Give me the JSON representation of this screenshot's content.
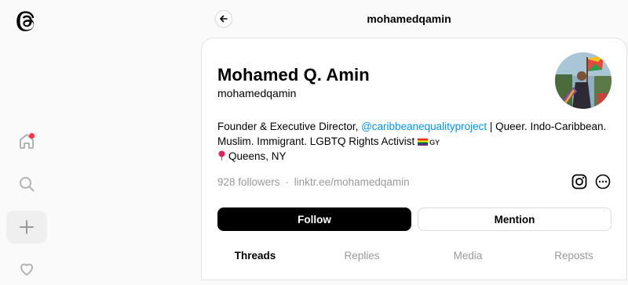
{
  "nav": {
    "items": [
      "home",
      "search",
      "create",
      "activity"
    ]
  },
  "header": {
    "title": "mohamedqamin"
  },
  "profile": {
    "name": "Mohamed Q. Amin",
    "handle": "mohamedqamin",
    "bio_line1_prefix": "Founder & Executive Director, ",
    "bio_mention": "@caribbeanequalityproject",
    "bio_line1_suffix": " | Queer. Indo-Caribbean.",
    "bio_line2": "Muslim. Immigrant. LGBTQ Rights Activist ",
    "bio_flag_code": "GY",
    "bio_location": "Queens, NY",
    "followers": "928 followers",
    "separator": "·",
    "link": "linktr.ee/mohamedqamin"
  },
  "actions": {
    "follow": "Follow",
    "mention": "Mention"
  },
  "tabs": [
    {
      "label": "Threads",
      "active": true
    },
    {
      "label": "Replies",
      "active": false
    },
    {
      "label": "Media",
      "active": false
    },
    {
      "label": "Reposts",
      "active": false
    }
  ],
  "colors": {
    "accent_link": "#0095f6",
    "notification": "#ff3040",
    "primary_button": "#000000"
  }
}
